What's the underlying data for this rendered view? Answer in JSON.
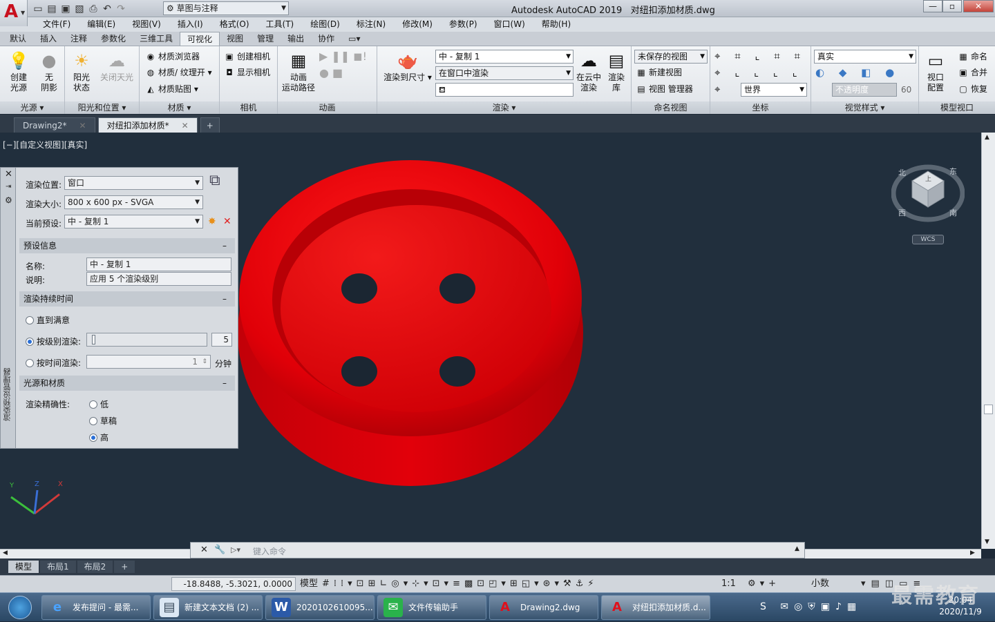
{
  "app": {
    "title": "Autodesk AutoCAD 2019",
    "file": "对纽扣添加材质.dwg",
    "workspace": "草图与注释"
  },
  "menus": [
    "文件(F)",
    "编辑(E)",
    "视图(V)",
    "插入(I)",
    "格式(O)",
    "工具(T)",
    "绘图(D)",
    "标注(N)",
    "修改(M)",
    "参数(P)",
    "窗口(W)",
    "帮助(H)"
  ],
  "ribbon_tabs": [
    "默认",
    "插入",
    "注释",
    "参数化",
    "三维工具",
    "可视化",
    "视图",
    "管理",
    "输出",
    "协作"
  ],
  "ribbon_active_tab": "可视化",
  "ribbon": {
    "light": {
      "title": "光源",
      "create": "创建\n光源",
      "shadow": "无\n阴影"
    },
    "sun": {
      "title": "阳光和位置",
      "sun_state": "阳光\n状态",
      "sky_off": "关闭天光"
    },
    "materials": {
      "title": "材质",
      "browser": "材质浏览器",
      "texture": "材质/ 纹理开",
      "mapping": "材质贴图"
    },
    "camera": {
      "title": "相机",
      "create": "创建相机",
      "show": "显示相机"
    },
    "animation": {
      "title": "动画",
      "motion_path": "动画\n运动路径"
    },
    "render": {
      "title": "渲染",
      "render_to_size": "渲染到尺寸",
      "preset": "中 - 复制 1",
      "target": "在窗口中渲染",
      "cloud": "在云中\n渲染",
      "library": "渲染\n库"
    },
    "named_views": {
      "title": "命名视图",
      "unsaved": "未保存的视图",
      "new_view": "新建视图",
      "manager": "视图 管理器"
    },
    "coordinates": {
      "title": "坐标",
      "world": "世界"
    },
    "visual_styles": {
      "title": "视觉样式",
      "style": "真实",
      "opacity_label": "不透明度",
      "opacity_value": "60"
    },
    "model_viewports": {
      "title": "模型视口",
      "config": "视口\n配置",
      "name": "命名",
      "join": "合并",
      "restore": "恢复"
    }
  },
  "doc_tabs": [
    {
      "label": "Drawing2*"
    },
    {
      "label": "对纽扣添加材质*"
    }
  ],
  "view_label": "[−][自定义视图][真实]",
  "palette": {
    "side_title": "渲染预设管理器",
    "render_location_label": "渲染位置:",
    "render_location": "窗口",
    "render_size_label": "渲染大小:",
    "render_size": "800 x 600 px - SVGA",
    "current_preset_label": "当前预设:",
    "current_preset": "中 - 复制 1",
    "preset_info": {
      "title": "预设信息",
      "name_label": "名称:",
      "name": "中 - 复制 1",
      "desc_label": "说明:",
      "desc": "应用 5 个渲染级别"
    },
    "duration": {
      "title": "渲染持续时间",
      "until_satisfied": "直到满意",
      "by_level": "按级别渲染:",
      "level_value": "5",
      "by_time": "按时间渲染:",
      "time_value": "1",
      "time_unit": "分钟",
      "level_fraction": 0.04
    },
    "lighting": {
      "title": "光源和材质",
      "accuracy_label": "渲染精确性:",
      "low": "低",
      "draft": "草稿",
      "high": "高"
    }
  },
  "viewcube": {
    "top": "上",
    "north": "北",
    "east": "东",
    "south": "南",
    "west": "西",
    "wcs": "WCS"
  },
  "ucs": {
    "x": "X",
    "y": "Y",
    "z": "Z"
  },
  "command_placeholder": "键入命令",
  "layout_tabs": [
    "模型",
    "布局1",
    "布局2"
  ],
  "status": {
    "coords": "-18.8488, -5.3021, 0.0000",
    "model": "模型",
    "scale": "1:1",
    "units": "小数"
  },
  "taskbar": [
    {
      "label": "发布提问 - 最需..."
    },
    {
      "label": "新建文本文档 (2) ..."
    },
    {
      "label": "2020102610095..."
    },
    {
      "label": "文件传输助手"
    },
    {
      "label": "Drawing2.dwg"
    },
    {
      "label": "对纽扣添加材质.d..."
    }
  ],
  "clock": {
    "time": "20:04",
    "date": "2020/11/9"
  },
  "watermark": "最需教育",
  "colors": {
    "button_red": "#e0000a",
    "viewport_bg": "#212f3d"
  }
}
